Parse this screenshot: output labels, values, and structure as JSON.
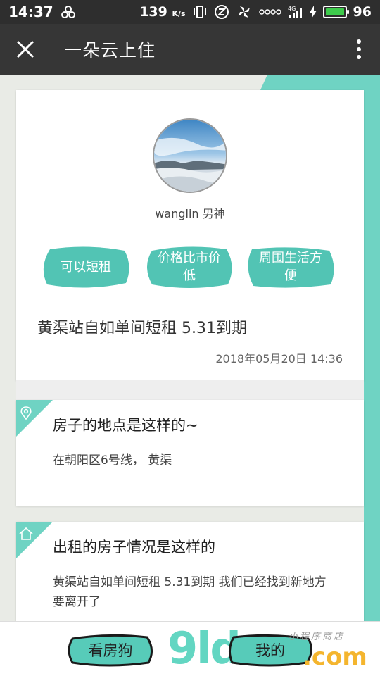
{
  "status_bar": {
    "time": "14:37",
    "speed_value": "139",
    "speed_unit": "K/s",
    "battery": "96",
    "network": "4G",
    "colors": {
      "battery_fill": "#3ecb4c"
    }
  },
  "nav": {
    "title": "一朵云上住",
    "close_icon": "close-icon",
    "more_icon": "more-vertical-icon"
  },
  "profile": {
    "username": "wanglin 男神",
    "tags": [
      "可以短租",
      "价格比市价低",
      "周围生活方便"
    ],
    "post_title": "黄渠站自如单间短租 5.31到期",
    "post_date": "2018年05月20日 14:36"
  },
  "sections": [
    {
      "icon": "location-pin-icon",
      "title": "房子的地点是这样的~",
      "body": "在朝阳区6号线，  黄渠"
    },
    {
      "icon": "house-icon",
      "title": "出租的房子情况是这样的",
      "body": "黄渠站自如单间短租 5.31到期 我们已经找到新地方要离开了"
    }
  ],
  "bottom": {
    "left_tab": "看房狗",
    "right_tab": "我的",
    "watermark_main": "9ld",
    "watermark_com": ".com",
    "watermark_small": "小程序商店"
  },
  "colors": {
    "teal": "#6fd3c3",
    "tag_teal": "#52c4b4",
    "nav_bg": "#363636",
    "status_bg": "#2e2e2e"
  }
}
